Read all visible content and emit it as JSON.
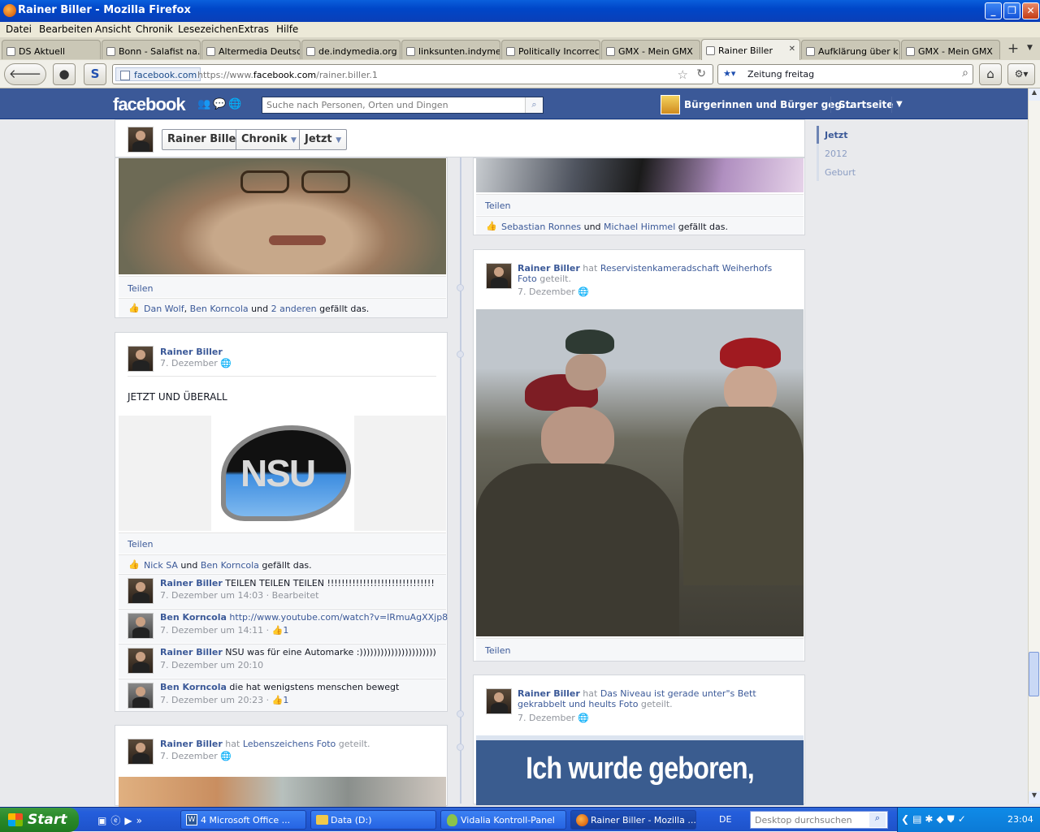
{
  "window": {
    "title": "Rainer Biller - Mozilla Firefox",
    "minimize": "_",
    "maximize": "❐",
    "close": "✕"
  },
  "menu": [
    "Datei",
    "Bearbeiten",
    "Ansicht",
    "Chronik",
    "Lesezeichen",
    "Extras",
    "Hilfe"
  ],
  "tabs": [
    "DS Aktuell",
    "Bonn - Salafist na...",
    "Altermedia Deutsc...",
    "de.indymedia.org ...",
    "linksunten.indyme...",
    "Politically Incorrect",
    "GMX - Mein GMX",
    "Rainer Biller",
    "Aufklärung über k...",
    "GMX - Mein GMX"
  ],
  "new_tab": "+",
  "nav": {
    "site": "facebook.com",
    "url_prefix": "https://www.",
    "url_domain": "facebook.com",
    "url_path": "/rainer.biller.1",
    "search_value": "Zeitung freitag"
  },
  "facebook": {
    "logo": "facebook",
    "search_placeholder": "Suche nach Personen, Orten und Dingen",
    "group_link": "Bürgerinnen und Bürger geg...",
    "home": "Startseite"
  },
  "timeline_header": {
    "name": "Rainer Biller",
    "chronik": "Chronik",
    "jetzt": "Jetzt"
  },
  "timeline_nav": [
    "Jetzt",
    "2012",
    "Geburt"
  ],
  "left_col": {
    "card1": {
      "share": "Teilen",
      "like_names": [
        "Dan Wolf",
        "Ben Korncola",
        "2 anderen"
      ],
      "like_and": "und",
      "like_suffix": "gefällt das."
    },
    "card2": {
      "author": "Rainer Biller",
      "date": "7. Dezember",
      "text": "JETZT UND ÜBERALL",
      "logo_text": "NSU",
      "share": "Teilen",
      "like_names": [
        "Nick SA",
        "Ben Korncola"
      ],
      "like_and": "und",
      "like_suffix": "gefällt das.",
      "comments": [
        {
          "author": "Rainer Biller",
          "text": "TEILEN TEILEN TEILEN !!!!!!!!!!!!!!!!!!!!!!!!!!!!!!",
          "meta": "7. Dezember um 14:03 · Bearbeitet",
          "likes": ""
        },
        {
          "author": "Ben Korncola",
          "text": "http://www.youtube.com/watch?v=lRmuAgXXjp8",
          "meta": "7. Dezember um 14:11 · ",
          "likes": "1"
        },
        {
          "author": "Rainer Biller",
          "text": "NSU was für eine Automarke :))))))))))))))))))))))",
          "meta": "7. Dezember um 20:10",
          "likes": ""
        },
        {
          "author": "Ben Korncola",
          "text": "die hat wenigstens menschen bewegt",
          "meta": "7. Dezember um 20:23 · ",
          "likes": "1"
        }
      ]
    },
    "card3": {
      "author": "Rainer Biller",
      "verb": "hat",
      "source": "Lebenszeichens Foto",
      "suffix": "geteilt.",
      "date": "7. Dezember"
    }
  },
  "right_col": {
    "card1": {
      "share": "Teilen",
      "like_names": [
        "Sebastian Ronnes",
        "Michael Himmel"
      ],
      "like_and": "und",
      "like_suffix": "gefällt das."
    },
    "card2": {
      "author": "Rainer Biller",
      "verb": "hat",
      "source": "Reservistenkameradschaft Weiherhofs Foto",
      "suffix": "geteilt.",
      "date": "7. Dezember",
      "share": "Teilen"
    },
    "card3": {
      "author": "Rainer Biller",
      "verb": "hat",
      "source": "Das Niveau ist gerade unter\"s Bett gekrabbelt und heults Foto",
      "suffix": "geteilt.",
      "date": "7. Dezember",
      "image_text": "Ich wurde geboren,"
    }
  },
  "taskbar": {
    "start": "Start",
    "tasks": [
      "4 Microsoft Office ...",
      "Data (D:)",
      "Vidalia Kontroll-Panel",
      "Rainer Biller - Mozilla ..."
    ],
    "lang": "DE",
    "desktop_search_placeholder": "Desktop durchsuchen",
    "clock": "23:04"
  }
}
